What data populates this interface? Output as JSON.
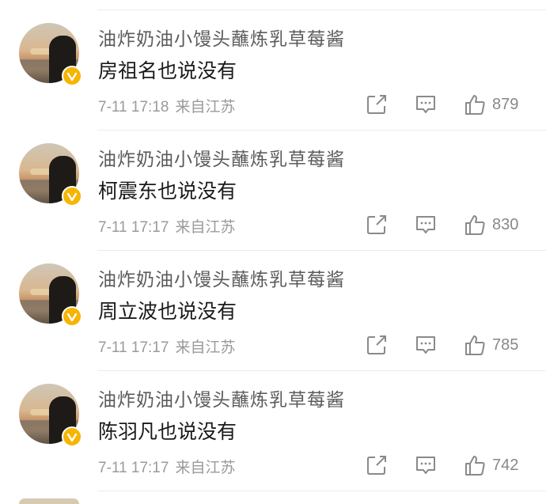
{
  "comments": [
    {
      "username": "油炸奶油小馒头蘸炼乳草莓酱",
      "content": "房祖名也说没有",
      "time": "7-11 17:18",
      "location": "来自江苏",
      "likes": "879"
    },
    {
      "username": "油炸奶油小馒头蘸炼乳草莓酱",
      "content": "柯震东也说没有",
      "time": "7-11 17:17",
      "location": "来自江苏",
      "likes": "830"
    },
    {
      "username": "油炸奶油小馒头蘸炼乳草莓酱",
      "content": "周立波也说没有",
      "time": "7-11 17:17",
      "location": "来自江苏",
      "likes": "785"
    },
    {
      "username": "油炸奶油小馒头蘸炼乳草莓酱",
      "content": "陈羽凡也说没有",
      "time": "7-11 17:17",
      "location": "来自江苏",
      "likes": "742"
    }
  ],
  "icons": {
    "share": "share-icon",
    "reply": "comment-icon",
    "like": "thumbs-up-icon",
    "verified": "verified-badge-icon"
  },
  "colors": {
    "verified_badge": "#f6b500",
    "username": "#5b5b5b",
    "content": "#1a1a1a",
    "meta": "#9a9a9a",
    "divider": "#ececec"
  }
}
